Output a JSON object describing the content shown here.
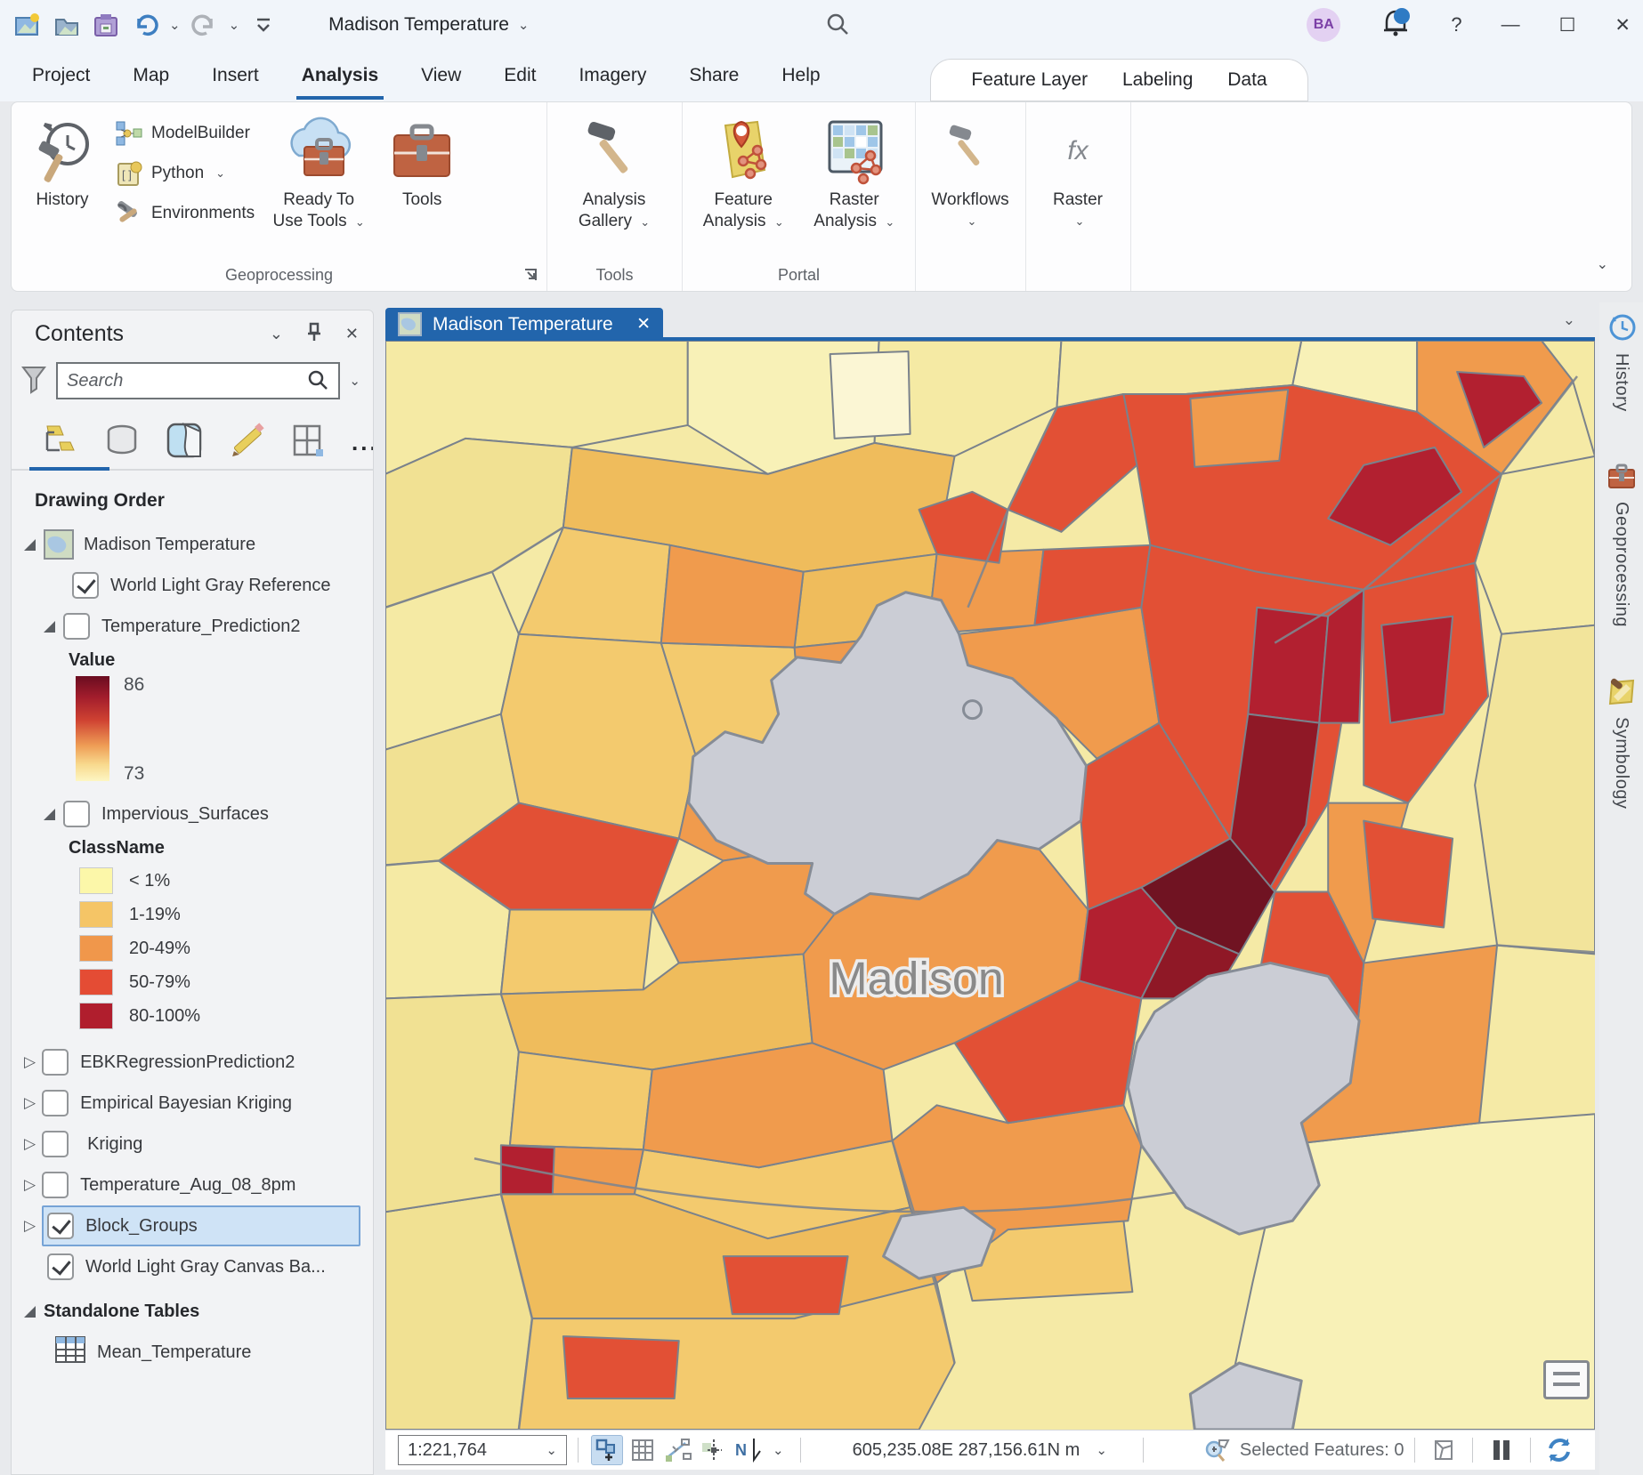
{
  "titlebar": {
    "title": "Madison Temperature",
    "avatar": "BA"
  },
  "menu": {
    "tabs": [
      "Project",
      "Map",
      "Insert",
      "Analysis",
      "View",
      "Edit",
      "Imagery",
      "Share",
      "Help"
    ],
    "active": "Analysis",
    "contextual": [
      "Feature Layer",
      "Labeling",
      "Data"
    ]
  },
  "ribbon": {
    "history": "History",
    "modelbuilder": "ModelBuilder",
    "python": "Python",
    "environments": "Environments",
    "ready1": "Ready To",
    "ready2": "Use Tools",
    "tools": "Tools",
    "gallery1": "Analysis",
    "gallery2": "Gallery",
    "feature1": "Feature",
    "feature2": "Analysis",
    "raster1": "Raster",
    "raster2": "Analysis",
    "workflows": "Workflows",
    "rasterfx": "Raster",
    "fx": "fx",
    "groups": [
      "Geoprocessing",
      "Tools",
      "Portal"
    ]
  },
  "contents": {
    "title": "Contents",
    "search_placeholder": "Search",
    "drawing_order": "Drawing Order",
    "layers": [
      {
        "label": "Madison Temperature"
      },
      {
        "label": "World Light Gray Reference",
        "checked": true
      },
      {
        "label": "Temperature_Prediction2",
        "checked": false
      },
      {
        "label": "Value"
      },
      {
        "top": "86",
        "bottom": "73"
      },
      {
        "label": "Impervious_Surfaces",
        "checked": false
      },
      {
        "label": "ClassName"
      },
      {
        "label": "< 1%",
        "color": "#FCF7A9"
      },
      {
        "label": "1-19%",
        "color": "#F5C566"
      },
      {
        "label": "20-49%",
        "color": "#F0974B"
      },
      {
        "label": "50-79%",
        "color": "#E44C34"
      },
      {
        "label": "80-100%",
        "color": "#B01E2D"
      },
      {
        "label": "EBKRegressionPrediction2",
        "checked": false
      },
      {
        "label": "Empirical Bayesian Kriging",
        "checked": false
      },
      {
        "label": "Kriging",
        "checked": false
      },
      {
        "label": "Temperature_Aug_08_8pm",
        "checked": false
      },
      {
        "label": "Block_Groups",
        "checked": true,
        "selected": true
      },
      {
        "label": "World Light Gray Canvas Ba...",
        "checked": true
      },
      {
        "label": "Standalone Tables"
      },
      {
        "label": "Mean_Temperature"
      }
    ],
    "value_ramp_css": "linear-gradient(180deg,#6A0C20 0%,#A21D2C 20%,#CF4232 42%,#EE9C55 66%,#F8D98D 84%,#FDF6C3 100%)"
  },
  "map": {
    "tab": "Madison Temperature",
    "city": "Madison"
  },
  "statusbar": {
    "scale": "1:221,764",
    "coords": "605,235.08E 287,156.61N m",
    "selected": "Selected Features: 0",
    "north": "N"
  },
  "right_tabs": [
    "History",
    "Geoprocessing",
    "Symbology"
  ]
}
